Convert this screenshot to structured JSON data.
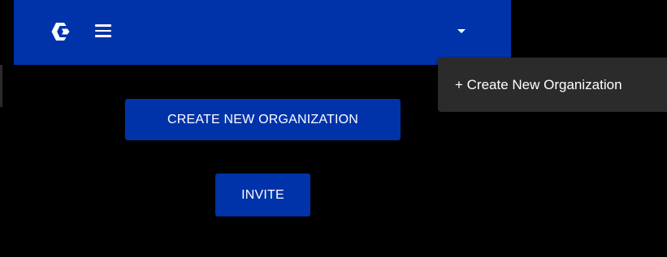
{
  "header": {
    "logo_icon": "graco-logo-icon",
    "menu_icon": "hamburger-menu-icon",
    "dropdown_icon": "caret-down-icon",
    "background_color": "#0033aa"
  },
  "dropdown_menu": {
    "items": [
      {
        "label": "+ Create New Organization"
      }
    ]
  },
  "main": {
    "create_button_label": "CREATE NEW ORGANIZATION",
    "invite_button_label": "INVITE"
  }
}
